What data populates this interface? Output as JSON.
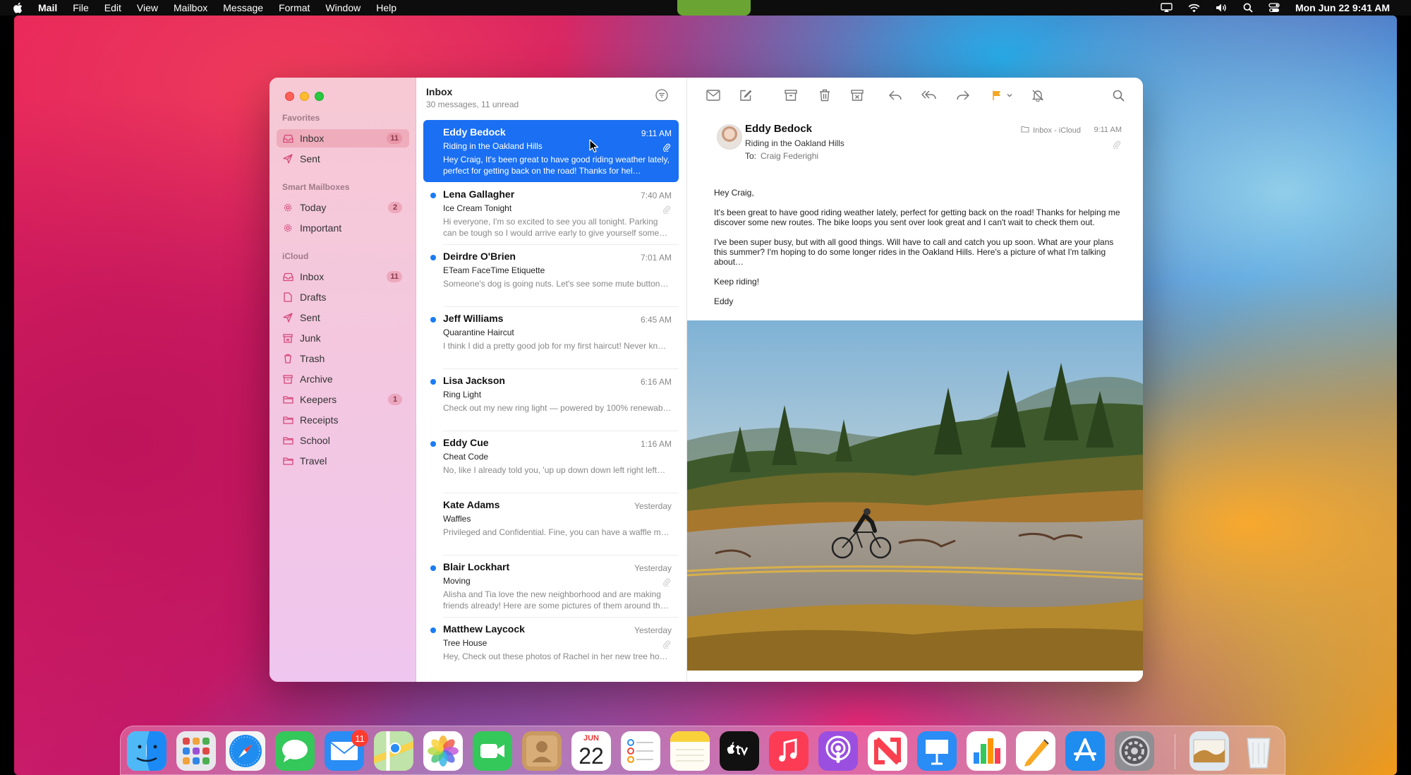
{
  "menubar": {
    "app": "Mail",
    "items": [
      "File",
      "Edit",
      "View",
      "Mailbox",
      "Message",
      "Format",
      "Window",
      "Help"
    ],
    "clock": "Mon Jun 22  9:41 AM"
  },
  "sidebar": {
    "favorites_label": "Favorites",
    "smart_label": "Smart Mailboxes",
    "icloud_label": "iCloud",
    "favorites": [
      {
        "label": "Inbox",
        "count": "11",
        "icon": "tray-icon"
      },
      {
        "label": "Sent",
        "icon": "paperplane-icon"
      }
    ],
    "smart": [
      {
        "label": "Today",
        "count": "2",
        "icon": "gear-icon"
      },
      {
        "label": "Important",
        "icon": "gear-icon"
      }
    ],
    "icloud": [
      {
        "label": "Inbox",
        "count": "11",
        "icon": "tray-icon"
      },
      {
        "label": "Drafts",
        "icon": "document-icon"
      },
      {
        "label": "Sent",
        "icon": "paperplane-icon"
      },
      {
        "label": "Junk",
        "icon": "junk-icon"
      },
      {
        "label": "Trash",
        "icon": "trash-icon"
      },
      {
        "label": "Archive",
        "icon": "archive-icon"
      },
      {
        "label": "Keepers",
        "count": "1",
        "icon": "folder-icon"
      },
      {
        "label": "Receipts",
        "icon": "folder-icon"
      },
      {
        "label": "School",
        "icon": "folder-icon"
      },
      {
        "label": "Travel",
        "icon": "folder-icon"
      }
    ]
  },
  "list": {
    "title": "Inbox",
    "subtitle": "30 messages, 11 unread",
    "messages": [
      {
        "from": "Eddy Bedock",
        "time": "9:11 AM",
        "subject": "Riding in the Oakland Hills",
        "preview": "Hey Craig, It's been great to have good riding weather lately, perfect for getting back on the road! Thanks for hel…"
      },
      {
        "from": "Lena Gallagher",
        "time": "7:40 AM",
        "subject": "Ice Cream Tonight",
        "preview": "Hi everyone, I'm so excited to see you all tonight. Parking can be tough so I would arrive early to give yourself some…"
      },
      {
        "from": "Deirdre O'Brien",
        "time": "7:01 AM",
        "subject": "ETeam FaceTime Etiquette",
        "preview": "Someone's dog is going nuts. Let's see some mute button…"
      },
      {
        "from": "Jeff Williams",
        "time": "6:45 AM",
        "subject": "Quarantine Haircut",
        "preview": "I think I did a pretty good job for my first haircut! Never kn…"
      },
      {
        "from": "Lisa Jackson",
        "time": "6:16 AM",
        "subject": "Ring Light",
        "preview": "Check out my new ring light — powered by 100% renewab…"
      },
      {
        "from": "Eddy Cue",
        "time": "1:16 AM",
        "subject": "Cheat Code",
        "preview": "No, like I already told you, 'up up down down left right left…"
      },
      {
        "from": "Kate Adams",
        "time": "Yesterday",
        "subject": "Waffles",
        "preview": "Privileged and Confidential. Fine, you can have a waffle m…"
      },
      {
        "from": "Blair Lockhart",
        "time": "Yesterday",
        "subject": "Moving",
        "preview": "Alisha and Tia love the new neighborhood and are making friends already! Here are some pictures of them around th…"
      },
      {
        "from": "Matthew Laycock",
        "time": "Yesterday",
        "subject": "Tree House",
        "preview": "Hey, Check out these photos of Rachel in her new tree ho…"
      }
    ]
  },
  "reader": {
    "from": "Eddy Bedock",
    "subject": "Riding in the Oakland Hills",
    "to_label": "To:",
    "to_name": "Craig Federighi",
    "mailbox": "Inbox - iCloud",
    "time": "9:11 AM",
    "body": [
      "Hey Craig,",
      "It's been great to have good riding weather lately, perfect for getting back on the road! Thanks for helping me discover some new routes. The bike loops you sent over look great and I can't wait to check them out.",
      "I've been super busy, but with all good things. Will have to call and catch you up soon. What are your plans this summer? I'm hoping to do some longer rides in the Oakland Hills. Here's a picture of what I'm talking about…",
      "Keep riding!",
      "Eddy"
    ]
  },
  "dock": {
    "mail_badge": "11",
    "calendar_month": "JUN",
    "calendar_day": "22"
  },
  "colors": {
    "accent": "#1a6ff2",
    "unread_dot": "#1a7cf5",
    "flag": "#f5a623"
  }
}
